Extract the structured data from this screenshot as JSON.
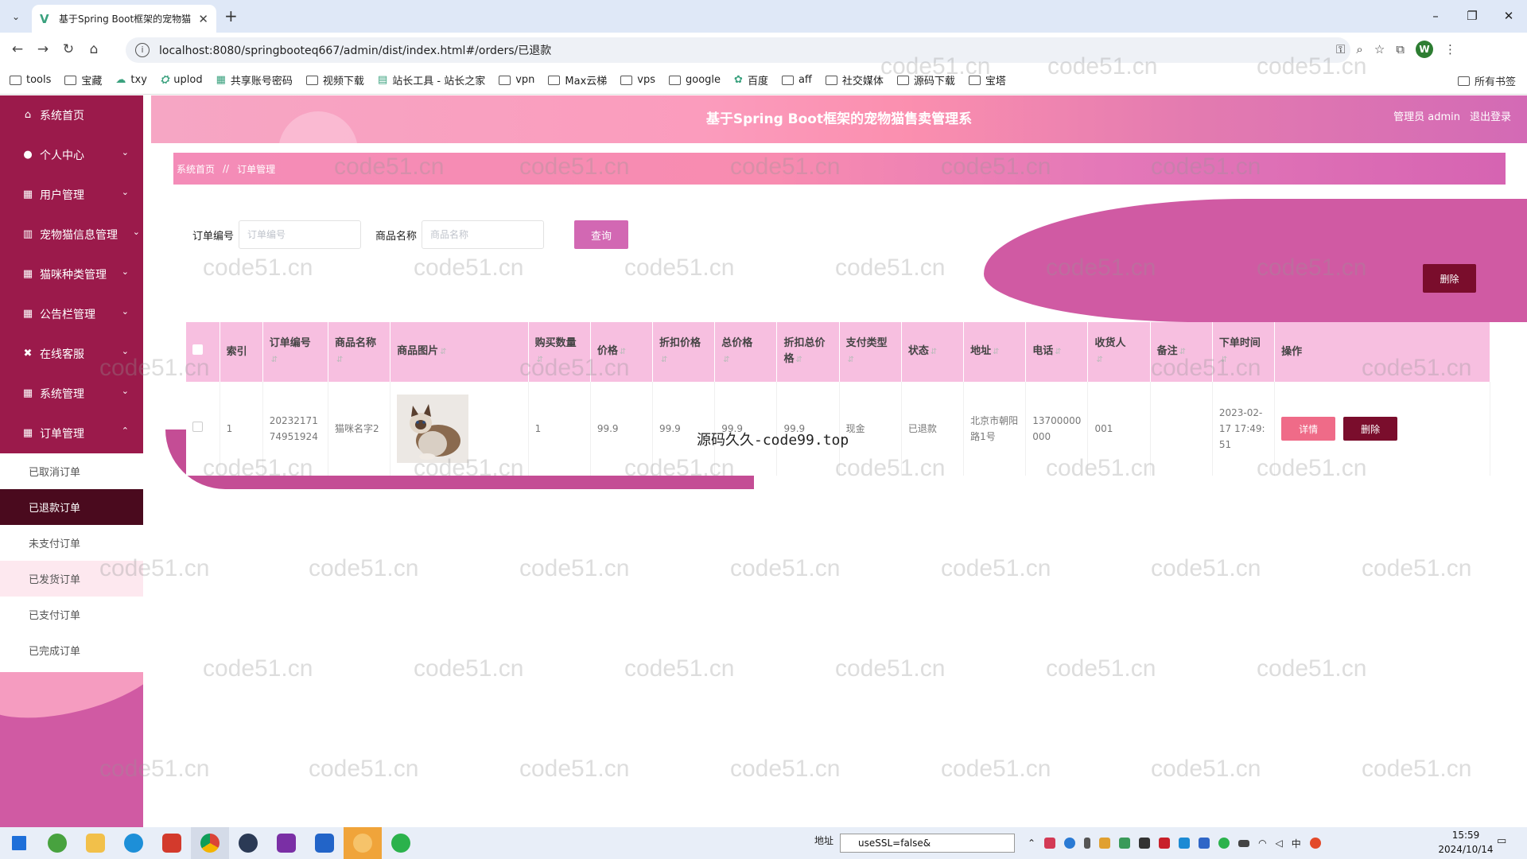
{
  "browser": {
    "tab_title": "基于Spring Boot框架的宠物猫",
    "url": "localhost:8080/springbooteq667/admin/dist/index.html#/orders/已退款",
    "profile_initial": "W",
    "bookmarks": [
      "tools",
      "宝藏",
      "txy",
      "uplod",
      "共享账号密码",
      "视频下载",
      "站长工具 - 站长之家",
      "vpn",
      "Max云梯",
      "vps",
      "google",
      "百度",
      "aff",
      "社交媒体",
      "源码下载",
      "宝塔"
    ],
    "all_bookmarks": "所有书签"
  },
  "app": {
    "title": "基于Spring Boot框架的宠物猫售卖管理系",
    "user_label": "管理员 admin",
    "logout": "退出登录",
    "breadcrumb": {
      "home": "系统首页",
      "sep": "//",
      "current": "订单管理"
    }
  },
  "sidebar": {
    "items": [
      {
        "label": "系统首页",
        "icon": "home-icon"
      },
      {
        "label": "个人中心",
        "icon": "user-icon"
      },
      {
        "label": "用户管理",
        "icon": "grid-icon"
      },
      {
        "label": "宠物猫信息管理",
        "icon": "chart-icon"
      },
      {
        "label": "猫咪种类管理",
        "icon": "grid-icon"
      },
      {
        "label": "公告栏管理",
        "icon": "grid-icon"
      },
      {
        "label": "在线客服",
        "icon": "support-icon"
      },
      {
        "label": "系统管理",
        "icon": "grid-icon"
      },
      {
        "label": "订单管理",
        "icon": "grid-icon"
      }
    ],
    "sub_items": [
      "已取消订单",
      "已退款订单",
      "未支付订单",
      "已发货订单",
      "已支付订单",
      "已完成订单"
    ],
    "active_sub": "已退款订单"
  },
  "search": {
    "order_no_label": "订单编号",
    "order_no_placeholder": "订单编号",
    "product_label": "商品名称",
    "product_placeholder": "商品名称",
    "query_button": "查询"
  },
  "delete_button": "删除",
  "table": {
    "headers": [
      "索引",
      "订单编号",
      "商品名称",
      "商品图片",
      "购买数量",
      "价格",
      "折扣价格",
      "总价格",
      "折扣总价格",
      "支付类型",
      "状态",
      "地址",
      "电话",
      "收货人",
      "备注",
      "下单时间",
      "操作"
    ],
    "rows": [
      {
        "index": "1",
        "order_no": "2023217174951924",
        "product": "猫咪名字2",
        "qty": "1",
        "price": "99.9",
        "discount_price": "99.9",
        "total": "99.9",
        "discount_total": "99.9",
        "pay_type": "现金",
        "status": "已退款",
        "address": "北京市朝阳路1号",
        "phone": "13700000000",
        "receiver": "001",
        "remark": "",
        "time": "2023-02-17 17:49:51",
        "detail_btn": "详情",
        "delete_btn": "删除"
      }
    ]
  },
  "overlay_text": "源码久久-code99.top",
  "watermark": "code51.cn",
  "taskbar": {
    "addr_label": "地址",
    "addr_value": "useSSL=false&",
    "ime": "中",
    "time": "15:59",
    "date": "2024/10/14"
  }
}
